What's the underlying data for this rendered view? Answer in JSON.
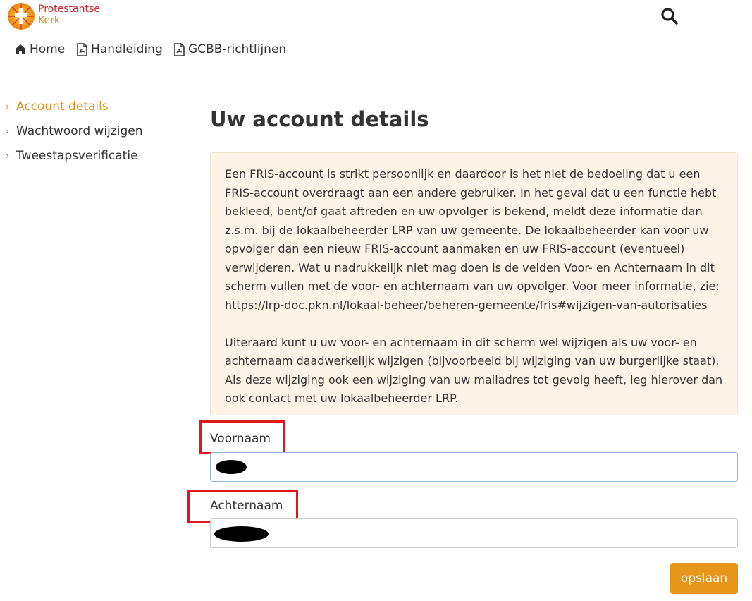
{
  "header": {
    "logo_line1": "Protestantse",
    "logo_line2": "Kerk",
    "logo_colors": [
      "#d2232a",
      "#e8891a"
    ]
  },
  "nav": {
    "items": [
      {
        "label": "Home",
        "icon": "home-icon"
      },
      {
        "label": "Handleiding",
        "icon": "pdf-file-icon"
      },
      {
        "label": "GCBB-richtlijnen",
        "icon": "pdf-file-icon"
      }
    ],
    "search_icon": "search-icon"
  },
  "sidebar": {
    "items": [
      {
        "label": "Account details",
        "active": true
      },
      {
        "label": "Wachtwoord wijzigen",
        "active": false
      },
      {
        "label": "Tweestapsverificatie",
        "active": false
      }
    ],
    "accent_color": "#e8891a"
  },
  "main": {
    "title": "Uw account details",
    "notice": {
      "paragraph1": "Een FRIS-account is strikt persoonlijk en daardoor is het niet de bedoeling dat u een FRIS-account overdraagt aan een andere gebruiker. In het geval dat u een functie hebt bekleed, bent/of gaat aftreden en uw opvolger is bekend, meldt deze informatie dan z.s.m. bij de lokaalbeheerder LRP van uw gemeente. De lokaalbeheerder kan voor uw opvolger dan een nieuw FRIS-account aanmaken en uw FRIS-account (eventueel) verwijderen. Wat u nadrukkelijk niet mag doen is de velden Voor- en Achternaam in dit scherm vullen met de voor- en achternaam van uw opvolger. Voor meer informatie, zie:",
      "link": "https://lrp-doc.pkn.nl/lokaal-beheer/beheren-gemeente/fris#wijzigen-van-autorisaties",
      "paragraph2": "Uiteraard kunt u uw voor- en achternaam in dit scherm wel wijzigen als uw voor- en achternaam daadwerkelijk wijzigen (bijvoorbeeld bij wijziging van uw burgerlijke staat). Als deze wijziging ook een wijziging van uw mailadres tot gevolg heeft, leg hierover dan ook contact met uw lokaalbeheerder LRP.",
      "background": "#fdf3e6"
    },
    "form": {
      "first_name_label": "Voornaam",
      "last_name_label": "Achternaam",
      "save_label": "opslaan",
      "save_color": "#e8961a",
      "highlight_color": "#e0161d"
    }
  }
}
